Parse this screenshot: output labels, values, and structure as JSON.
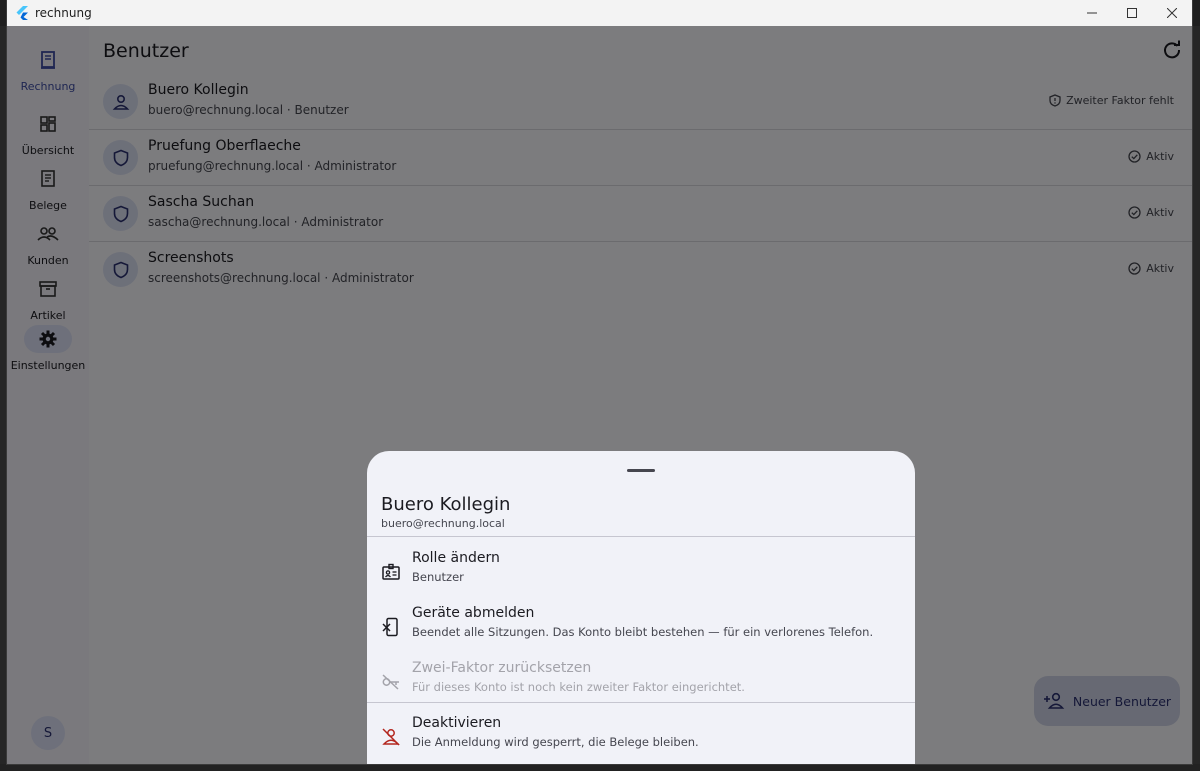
{
  "window": {
    "title": "rechnung"
  },
  "rail": {
    "items": [
      {
        "label": "Rechnung",
        "icon": "receipt-icon",
        "selected": true
      },
      {
        "label": "Übersicht",
        "icon": "dashboard-icon"
      },
      {
        "label": "Belege",
        "icon": "document-icon"
      },
      {
        "label": "Kunden",
        "icon": "people-icon"
      },
      {
        "label": "Artikel",
        "icon": "archive-icon"
      },
      {
        "label": "Einstellungen",
        "icon": "gear-icon",
        "active": true
      }
    ],
    "avatar": "S"
  },
  "main": {
    "title": "Benutzer",
    "users": [
      {
        "name": "Buero Kollegin",
        "sub": "buero@rechnung.local · Benutzer",
        "status": "Zweiter Faktor fehlt",
        "icon": "person-icon",
        "status_icon": "shield-icon"
      },
      {
        "name": "Pruefung Oberflaeche",
        "sub": "pruefung@rechnung.local · Administrator",
        "status": "Aktiv",
        "icon": "shield-icon",
        "status_icon": "check-circle-icon"
      },
      {
        "name": "Sascha Suchan",
        "sub": "sascha@rechnung.local · Administrator",
        "status": "Aktiv",
        "icon": "shield-icon",
        "status_icon": "check-circle-icon"
      },
      {
        "name": "Screenshots",
        "sub": "screenshots@rechnung.local · Administrator",
        "status": "Aktiv",
        "icon": "shield-icon",
        "status_icon": "check-circle-icon"
      }
    ]
  },
  "fab": {
    "label": "Neuer Benutzer"
  },
  "sheet": {
    "title": "Buero Kollegin",
    "subtitle": "buero@rechnung.local",
    "actions": [
      {
        "label": "Rolle ändern",
        "desc": "Benutzer",
        "icon": "badge-icon"
      },
      {
        "label": "Geräte abmelden",
        "desc": "Beendet alle Sitzungen. Das Konto bleibt bestehen — für ein verlorenes Telefon.",
        "icon": "phone-off-icon"
      },
      {
        "label": "Zwei-Faktor zurücksetzen",
        "desc": "Für dieses Konto ist noch kein zweiter Faktor eingerichtet.",
        "icon": "key-off-icon",
        "disabled": true
      },
      {
        "label": "Deaktivieren",
        "desc": "Die Anmeldung wird gesperrt, die Belege bleiben.",
        "icon": "person-off-icon",
        "danger": true
      }
    ]
  },
  "colors": {
    "accent": "#3f4da4",
    "danger": "#b3261e",
    "scrim": "rgba(0,0,0,0.5)"
  }
}
